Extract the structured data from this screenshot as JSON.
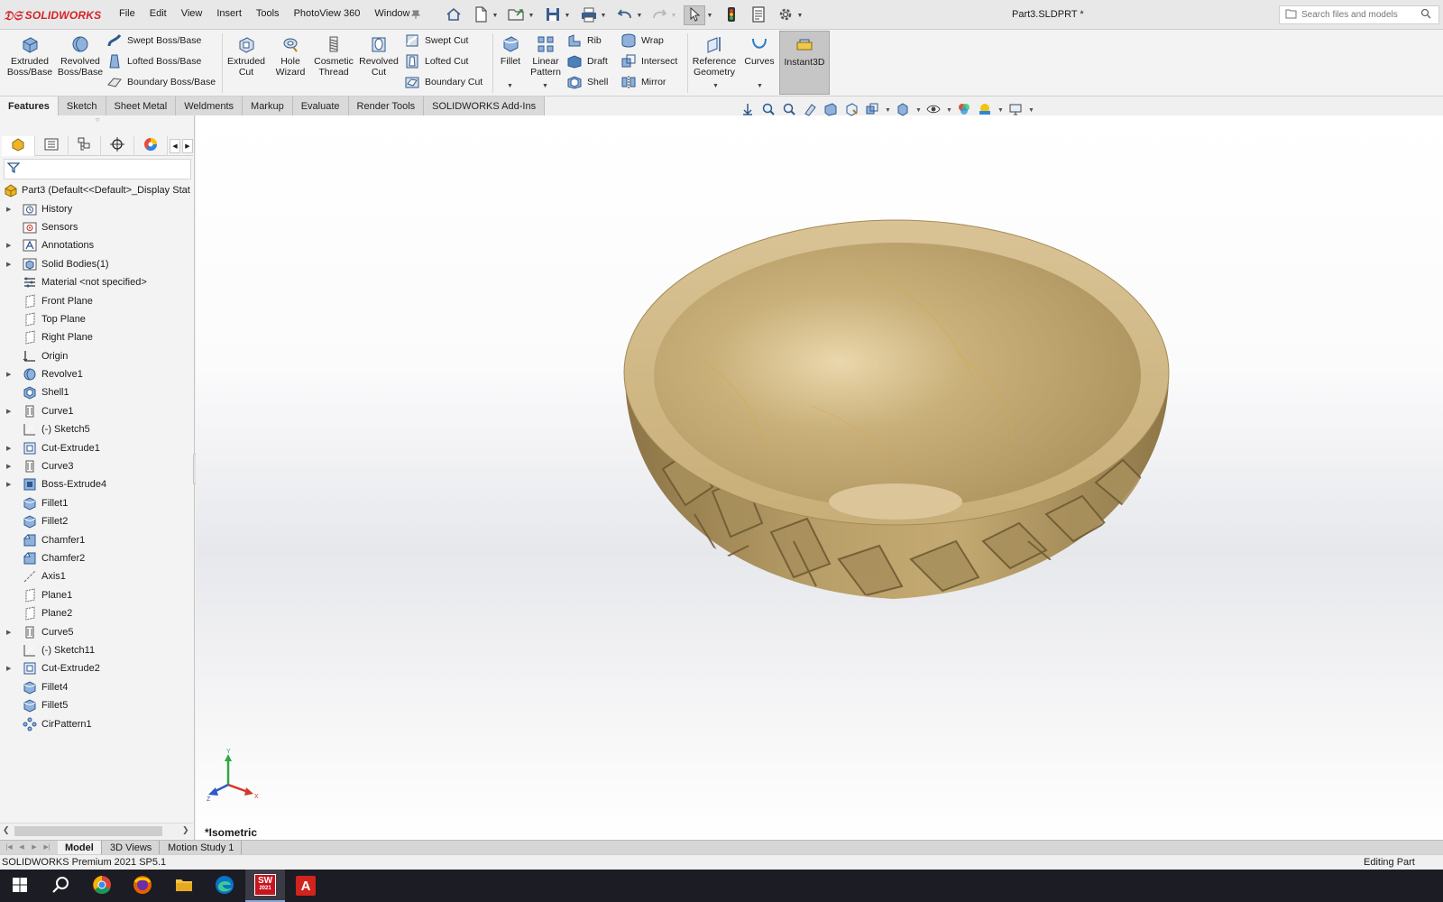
{
  "app": {
    "brand": "SOLIDWORKS",
    "document_title": "Part3.SLDPRT *",
    "search_placeholder": "Search files and models"
  },
  "menu": [
    "File",
    "Edit",
    "View",
    "Insert",
    "Tools",
    "PhotoView 360",
    "Window"
  ],
  "ribbon": {
    "extruded_boss": [
      "Extruded",
      "Boss/Base"
    ],
    "revolved_boss": [
      "Revolved",
      "Boss/Base"
    ],
    "swept_boss": "Swept Boss/Base",
    "lofted_boss": "Lofted Boss/Base",
    "boundary_boss": "Boundary Boss/Base",
    "extruded_cut": [
      "Extruded",
      "Cut"
    ],
    "hole_wizard": [
      "Hole",
      "Wizard"
    ],
    "cosmetic_thread": [
      "Cosmetic",
      "Thread"
    ],
    "revolved_cut": [
      "Revolved",
      "Cut"
    ],
    "swept_cut": "Swept Cut",
    "lofted_cut": "Lofted Cut",
    "boundary_cut": "Boundary Cut",
    "fillet": "Fillet",
    "linear_pattern": [
      "Linear",
      "Pattern"
    ],
    "rib": "Rib",
    "draft": "Draft",
    "shell": "Shell",
    "wrap": "Wrap",
    "intersect": "Intersect",
    "mirror": "Mirror",
    "reference_geometry": [
      "Reference",
      "Geometry"
    ],
    "curves": "Curves",
    "instant3d": "Instant3D"
  },
  "command_tabs": [
    "Features",
    "Sketch",
    "Sheet Metal",
    "Weldments",
    "Markup",
    "Evaluate",
    "Render Tools",
    "SOLIDWORKS Add-Ins"
  ],
  "active_command_tab": "Features",
  "feature_tree": {
    "root": "Part3  (Default<<Default>_Display Stat",
    "items": [
      {
        "label": "History",
        "icon": "history-icon",
        "expandable": true
      },
      {
        "label": "Sensors",
        "icon": "sensors-icon",
        "expandable": false
      },
      {
        "label": "Annotations",
        "icon": "annotations-icon",
        "expandable": true
      },
      {
        "label": "Solid Bodies(1)",
        "icon": "solid-bodies-icon",
        "expandable": true
      },
      {
        "label": "Material <not specified>",
        "icon": "material-icon",
        "expandable": false
      },
      {
        "label": "Front Plane",
        "icon": "plane-icon",
        "expandable": false
      },
      {
        "label": "Top Plane",
        "icon": "plane-icon",
        "expandable": false
      },
      {
        "label": "Right Plane",
        "icon": "plane-icon",
        "expandable": false
      },
      {
        "label": "Origin",
        "icon": "origin-icon",
        "expandable": false
      },
      {
        "label": "Revolve1",
        "icon": "revolve-icon",
        "expandable": true
      },
      {
        "label": "Shell1",
        "icon": "shell-icon",
        "expandable": false
      },
      {
        "label": "Curve1",
        "icon": "curve-icon",
        "expandable": true
      },
      {
        "label": "(-) Sketch5",
        "icon": "sketch-icon",
        "expandable": false
      },
      {
        "label": "Cut-Extrude1",
        "icon": "cut-extrude-icon",
        "expandable": true
      },
      {
        "label": "Curve3",
        "icon": "curve-icon",
        "expandable": true
      },
      {
        "label": "Boss-Extrude4",
        "icon": "boss-extrude-icon",
        "expandable": true
      },
      {
        "label": "Fillet1",
        "icon": "fillet-icon",
        "expandable": false
      },
      {
        "label": "Fillet2",
        "icon": "fillet-icon",
        "expandable": false
      },
      {
        "label": "Chamfer1",
        "icon": "chamfer-icon",
        "expandable": false
      },
      {
        "label": "Chamfer2",
        "icon": "chamfer-icon",
        "expandable": false
      },
      {
        "label": "Axis1",
        "icon": "axis-icon",
        "expandable": false
      },
      {
        "label": "Plane1",
        "icon": "plane-icon",
        "expandable": false
      },
      {
        "label": "Plane2",
        "icon": "plane-icon",
        "expandable": false
      },
      {
        "label": "Curve5",
        "icon": "curve-icon",
        "expandable": true
      },
      {
        "label": "(-) Sketch11",
        "icon": "sketch-icon",
        "expandable": false
      },
      {
        "label": "Cut-Extrude2",
        "icon": "cut-extrude-icon",
        "expandable": true
      },
      {
        "label": "Fillet4",
        "icon": "fillet-icon",
        "expandable": false
      },
      {
        "label": "Fillet5",
        "icon": "fillet-icon",
        "expandable": false
      },
      {
        "label": "CirPattern1",
        "icon": "circular-pattern-icon",
        "expandable": false
      }
    ]
  },
  "viewport": {
    "view_name": "*Isometric",
    "triad_labels": {
      "x": "X",
      "y": "Y",
      "z": "Z"
    }
  },
  "bottom_tabs": [
    "Model",
    "3D Views",
    "Motion Study 1"
  ],
  "active_bottom_tab": "Model",
  "status": {
    "left": "SOLIDWORKS Premium 2021 SP5.1",
    "right": "Editing Part"
  },
  "taskbar": {
    "solidworks_badge_top": "SW",
    "solidworks_badge_bottom": "2021",
    "acrobat_letter": "A"
  },
  "colors": {
    "brand_red": "#d32229",
    "wood_light": "#e0cc9f",
    "wood_dark": "#b59a64",
    "accent_blue": "#2f7fd0"
  }
}
